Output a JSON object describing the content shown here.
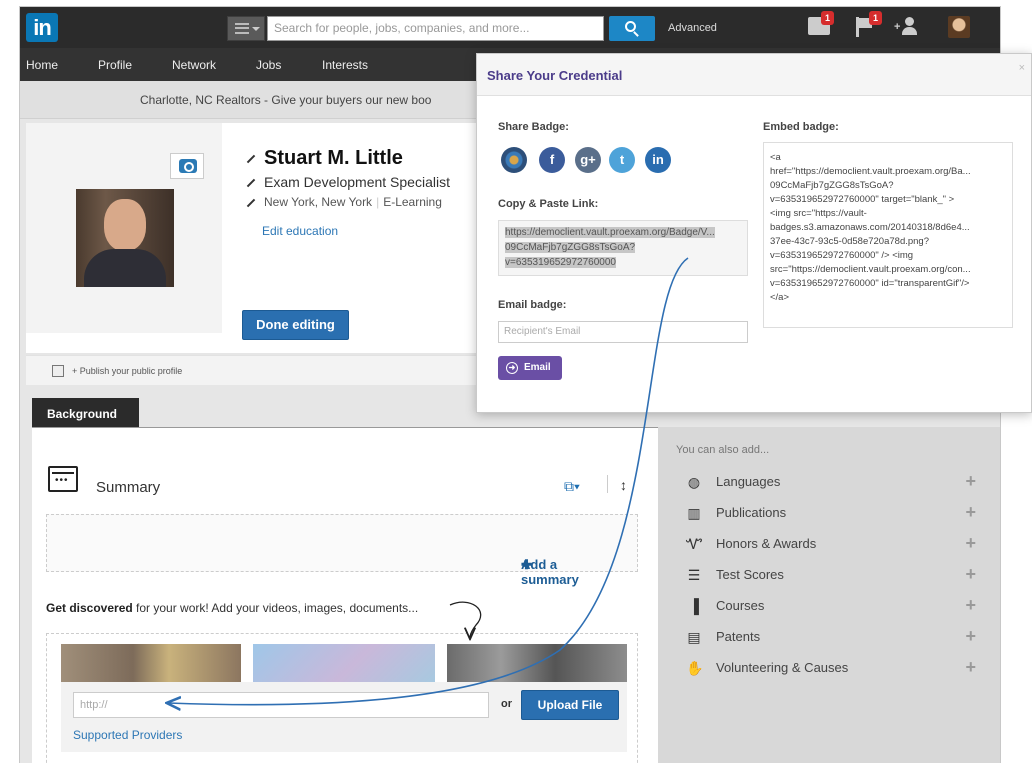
{
  "topbar": {
    "logo": "in",
    "search_placeholder": "Search for people, jobs, companies, and more...",
    "advanced": "Advanced",
    "mail_count": "1",
    "flag_count": "1"
  },
  "nav": {
    "items": [
      "Home",
      "Profile",
      "Network",
      "Jobs",
      "Interests"
    ]
  },
  "banner": "Charlotte, NC Realtors - Give your buyers our new boo",
  "profile": {
    "name": "Stuart M. Little",
    "headline": "Exam Development Specialist",
    "location": "New York, New York",
    "industry": "E-Learning",
    "edit_education": "Edit education",
    "done_editing": "Done editing",
    "publish": "+ Publish your public profile"
  },
  "background": {
    "tab": "Background",
    "summary_label": "Summary",
    "add_summary": "Add a summary",
    "get_discovered_bold": "Get discovered",
    "get_discovered_rest": " for your work! Add your videos, images, documents...",
    "url_placeholder": "http://",
    "or": "or",
    "upload": "Upload File",
    "supported": "Supported Providers"
  },
  "sidebar": {
    "heading": "You can also add...",
    "items": [
      {
        "label": "Languages",
        "icon": "globe-icon"
      },
      {
        "label": "Publications",
        "icon": "books-icon"
      },
      {
        "label": "Honors & Awards",
        "icon": "medal-icon"
      },
      {
        "label": "Test Scores",
        "icon": "scorecard-icon"
      },
      {
        "label": "Courses",
        "icon": "course-book-icon"
      },
      {
        "label": "Patents",
        "icon": "patent-icon"
      },
      {
        "label": "Volunteering & Causes",
        "icon": "hand-icon"
      }
    ]
  },
  "modal": {
    "title": "Share Your Credential",
    "close": "×",
    "share_badge": "Share Badge:",
    "social": [
      {
        "icon": "credential-badge-icon",
        "glyph": ""
      },
      {
        "icon": "facebook-icon",
        "glyph": "f"
      },
      {
        "icon": "google-plus-icon",
        "glyph": "g+"
      },
      {
        "icon": "twitter-icon",
        "glyph": "t"
      },
      {
        "icon": "linkedin-icon",
        "glyph": "in"
      }
    ],
    "copy_label": "Copy & Paste Link:",
    "copy_link_line1": "https://democlient.vault.proexam.org/Badge/V...",
    "copy_link_line2": "09CcMaFjb7gZGG8sTsGoA?",
    "copy_link_line3": "v=635319652972760000",
    "email_label": "Email badge:",
    "email_placeholder": "Recipient's Email",
    "email_button": "Email",
    "embed_label": "Embed badge:",
    "embed_lines": [
      "<a",
      "href=\"https://democlient.vault.proexam.org/Ba...",
      "09CcMaFjb7gZGG8sTsGoA?",
      "v=635319652972760000\" target=\"blank_\" >",
      "<img src=\"https://vault-",
      "badges.s3.amazonaws.com/20140318/8d6e4...",
      "37ee-43c7-93c5-0d58e720a78d.png?",
      "v=635319652972760000\" /> <img",
      "src=\"https://democlient.vault.proexam.org/con...",
      "v=635319652972760000\" id=\"transparentGif\"/>",
      "</a>"
    ]
  }
}
